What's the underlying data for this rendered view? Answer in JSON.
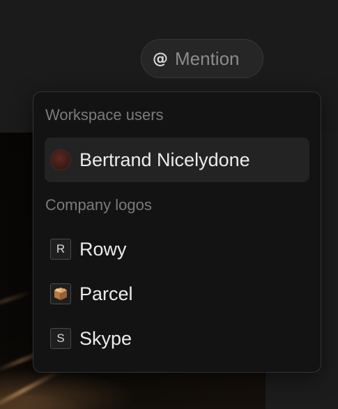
{
  "trigger": {
    "icon": "at-sign-icon",
    "symbol": "@",
    "label": "Mention"
  },
  "dropdown": {
    "sections": [
      {
        "label": "Workspace users",
        "items": [
          {
            "label": "Bertrand Nicelydone",
            "icon": "user-avatar",
            "highlighted": true
          }
        ]
      },
      {
        "label": "Company logos",
        "items": [
          {
            "label": "Rowy",
            "icon": "letter-logo",
            "initial": "R"
          },
          {
            "label": "Parcel",
            "icon": "box-icon"
          },
          {
            "label": "Skype",
            "icon": "letter-logo",
            "initial": "S"
          }
        ]
      }
    ]
  },
  "colors": {
    "panel_bg": "#131313",
    "highlight_bg": "#232323",
    "text": "#ececec",
    "muted_text": "#7b7b7b"
  }
}
